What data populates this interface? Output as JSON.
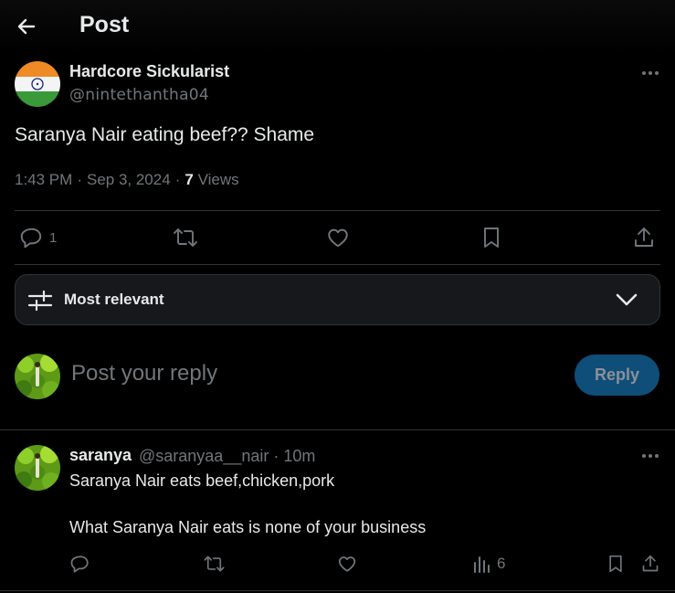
{
  "header": {
    "title": "Post"
  },
  "post": {
    "author_name": "Hardcore Sickularist",
    "author_handle": "@nintethantha04",
    "text": "Saranya Nair eating beef?? Shame",
    "time": "1:43 PM",
    "date": "Sep 3, 2024",
    "separator": "·",
    "views_count": "7",
    "views_label": "Views",
    "reply_count": "1"
  },
  "sort": {
    "label": "Most relevant"
  },
  "composer": {
    "placeholder": "Post your reply",
    "reply_label": "Reply"
  },
  "comment": {
    "name": "saranya",
    "handle_time": "@saranyaa__nair · 10m",
    "line1": "Saranya Nair eats beef,chicken,pork",
    "line2": "What Saranya Nair eats is none of your business",
    "views_count": "6"
  },
  "colors": {
    "accent": "#1d9bf0",
    "reply_button": "#0f4e78",
    "muted": "#71767b",
    "border": "#2f3336"
  },
  "icons": [
    "back-arrow-icon",
    "more-icon",
    "reply-icon",
    "repost-icon",
    "like-icon",
    "bookmark-icon",
    "share-icon",
    "sort-sliders-icon",
    "chevron-down-icon",
    "views-icon"
  ]
}
